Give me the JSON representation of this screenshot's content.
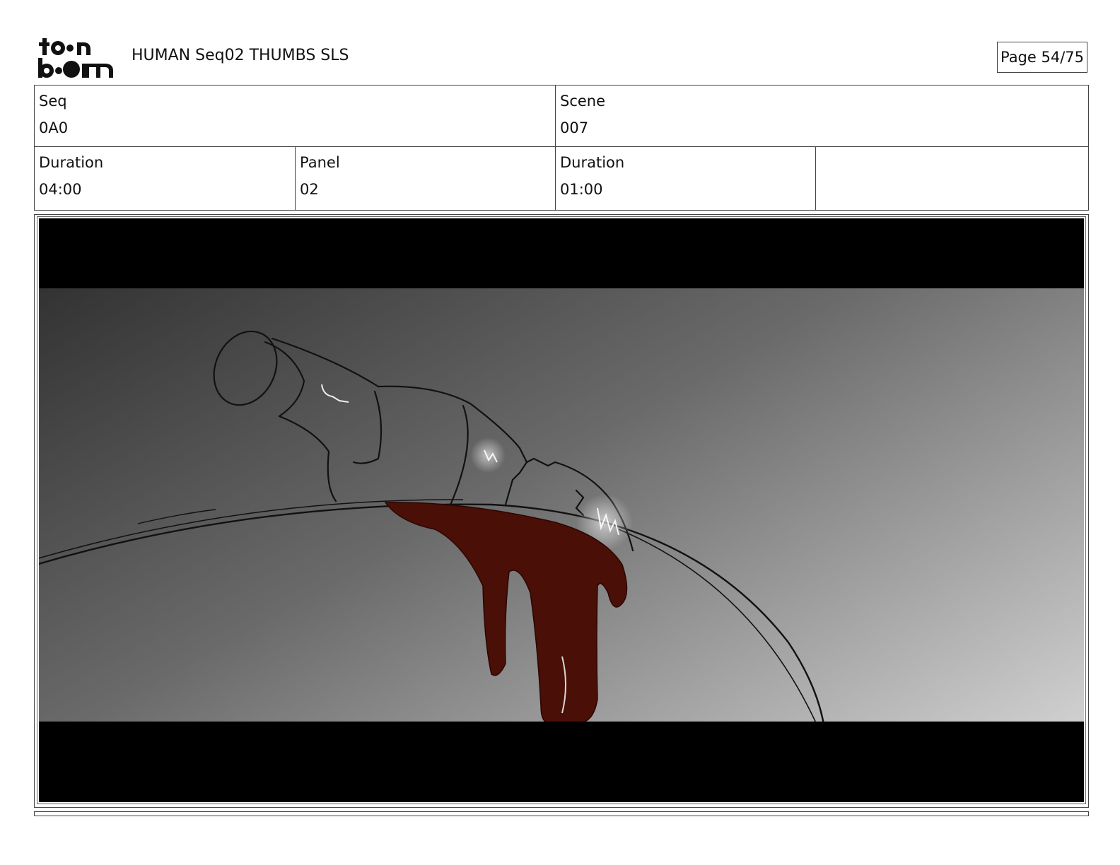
{
  "header": {
    "logo_text": "toonboom",
    "title": "HUMAN Seq02 THUMBS SLS",
    "page": "Page 54/75"
  },
  "info": {
    "seq": {
      "label": "Seq",
      "value": "0A0"
    },
    "scene": {
      "label": "Scene",
      "value": "007"
    },
    "duration_seq": {
      "label": "Duration",
      "value": "04:00"
    },
    "panel": {
      "label": "Panel",
      "value": "02"
    },
    "duration_panel": {
      "label": "Duration",
      "value": "01:00"
    }
  },
  "colors": {
    "letterbox": "#000000",
    "liquid": "#4a0f06",
    "sketch_line": "#111111"
  }
}
